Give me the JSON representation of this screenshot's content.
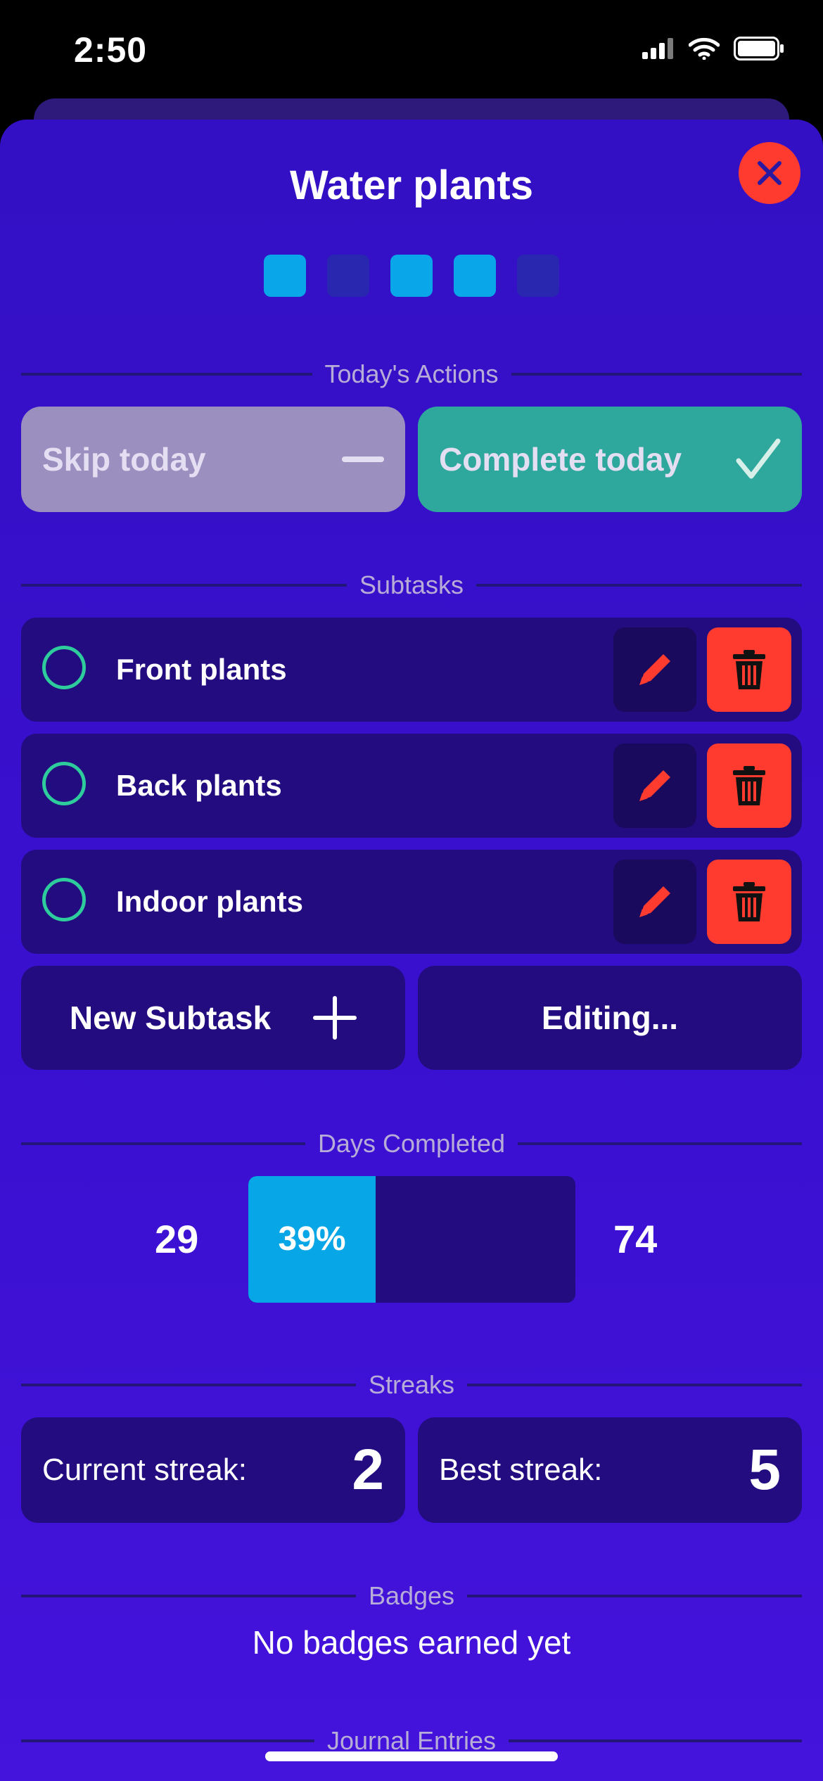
{
  "status_bar": {
    "time": "2:50"
  },
  "header": {
    "title": "Water plants"
  },
  "progress_dots": [
    true,
    false,
    true,
    true,
    false
  ],
  "sections": {
    "todays_actions": "Today's Actions",
    "subtasks": "Subtasks",
    "days_completed": "Days Completed",
    "streaks": "Streaks",
    "badges": "Badges",
    "journal_entries": "Journal Entries"
  },
  "actions": {
    "skip_label": "Skip today",
    "complete_label": "Complete today"
  },
  "subtasks": [
    {
      "name": "Front plants"
    },
    {
      "name": "Back plants"
    },
    {
      "name": "Indoor plants"
    }
  ],
  "subtask_buttons": {
    "new_subtask": "New Subtask",
    "editing": "Editing..."
  },
  "days_completed": {
    "completed": "29",
    "total": "74",
    "percent_label": "39%",
    "fraction": 0.39
  },
  "streaks": {
    "current_label": "Current streak:",
    "current_value": "2",
    "best_label": "Best streak:",
    "best_value": "5"
  },
  "badges": {
    "empty_text": "No badges earned yet"
  },
  "colors": {
    "accent_blue": "#07a6e6",
    "complete_green": "#2ea89c",
    "delete_red": "#ff3b30",
    "check_circle": "#2ecc9c"
  },
  "icons": {
    "close": "close-icon",
    "skip": "minus-icon",
    "complete": "checkmark-icon",
    "edit": "pencil-icon",
    "delete": "trash-icon",
    "add": "plus-icon"
  }
}
